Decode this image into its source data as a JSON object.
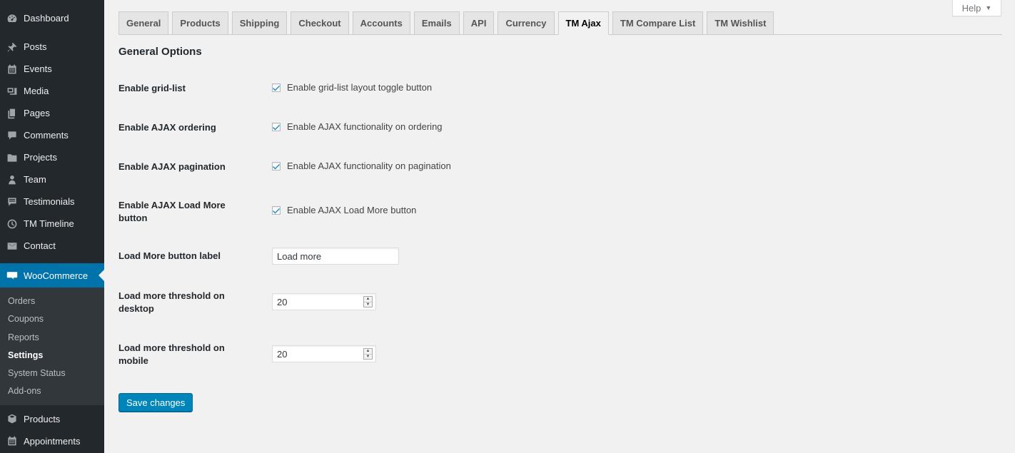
{
  "sidebar": {
    "top_items": [
      {
        "label": "Dashboard",
        "icon": "dashboard-icon"
      },
      {
        "label": "Posts",
        "icon": "pin-icon"
      },
      {
        "label": "Events",
        "icon": "calendar-icon"
      },
      {
        "label": "Media",
        "icon": "media-icon"
      },
      {
        "label": "Pages",
        "icon": "pages-icon"
      },
      {
        "label": "Comments",
        "icon": "comments-icon"
      },
      {
        "label": "Projects",
        "icon": "folder-icon"
      },
      {
        "label": "Team",
        "icon": "team-icon"
      },
      {
        "label": "Testimonials",
        "icon": "testimonials-icon"
      },
      {
        "label": "TM Timeline",
        "icon": "clock-icon"
      },
      {
        "label": "Contact",
        "icon": "mail-icon"
      }
    ],
    "woocommerce": {
      "label": "WooCommerce",
      "icon": "woo-icon"
    },
    "submenu": [
      "Orders",
      "Coupons",
      "Reports",
      "Settings",
      "System Status",
      "Add-ons"
    ],
    "submenu_current": "Settings",
    "bottom_items": [
      {
        "label": "Products",
        "icon": "box-icon"
      },
      {
        "label": "Appointments",
        "icon": "calendar-icon"
      }
    ]
  },
  "help": {
    "label": "Help"
  },
  "tabs": [
    "General",
    "Products",
    "Shipping",
    "Checkout",
    "Accounts",
    "Emails",
    "API",
    "Currency",
    "TM Ajax",
    "TM Compare List",
    "TM Wishlist"
  ],
  "active_tab": "TM Ajax",
  "section_title": "General Options",
  "fields": {
    "grid_list": {
      "label": "Enable grid-list",
      "desc": "Enable grid-list layout toggle button",
      "checked": true
    },
    "ajax_ordering": {
      "label": "Enable AJAX ordering",
      "desc": "Enable AJAX functionality on ordering",
      "checked": true
    },
    "ajax_pagination": {
      "label": "Enable AJAX pagination",
      "desc": "Enable AJAX functionality on pagination",
      "checked": true
    },
    "load_more_button": {
      "label": "Enable AJAX Load More button",
      "desc": "Enable AJAX Load More button",
      "checked": true
    },
    "load_more_label": {
      "label": "Load More button label",
      "value": "Load more"
    },
    "threshold_desktop": {
      "label": "Load more threshold on desktop",
      "value": "20"
    },
    "threshold_mobile": {
      "label": "Load more threshold on mobile",
      "value": "20"
    }
  },
  "save_button": "Save changes",
  "colors": {
    "sidebar_bg": "#23282d",
    "accent": "#0073aa",
    "button": "#0085ba",
    "page_bg": "#f1f1f1"
  }
}
